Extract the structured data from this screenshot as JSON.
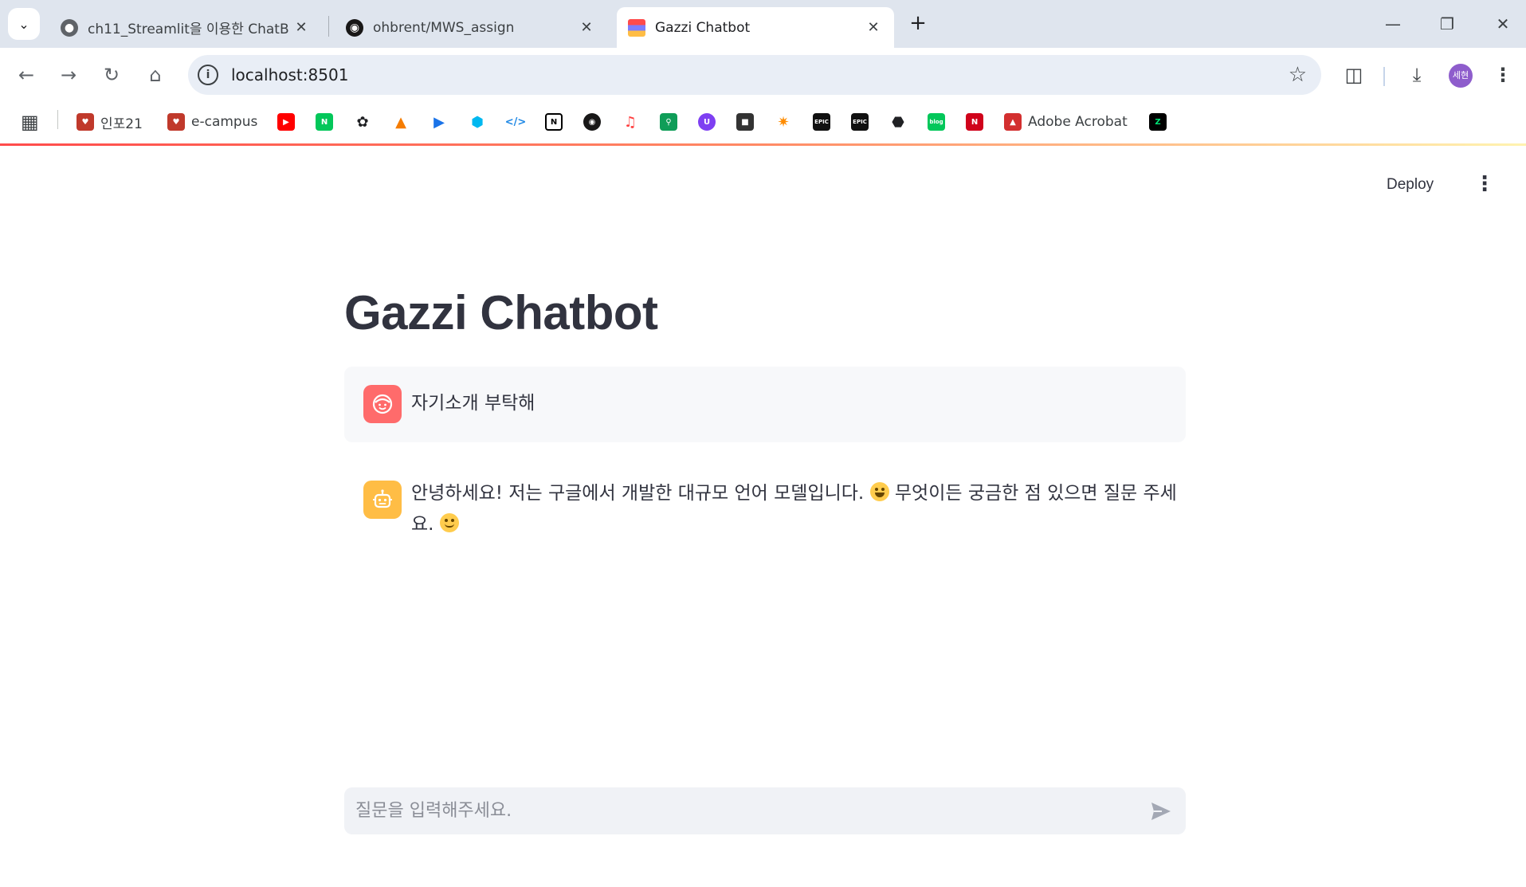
{
  "browser": {
    "tabs": [
      {
        "title": "ch11_Streamlit을 이용한 ChatB",
        "active": false
      },
      {
        "title": "ohbrent/MWS_assign",
        "active": false
      },
      {
        "title": "Gazzi Chatbot",
        "active": true
      }
    ],
    "url": "localhost:8501",
    "profile_initials": "세현",
    "bookmarks": [
      {
        "label": "인포21",
        "icon": "logo-icon",
        "color": "#c0392b"
      },
      {
        "label": "e-campus",
        "icon": "logo-icon",
        "color": "#c0392b"
      },
      {
        "label": "",
        "icon": "youtube-icon",
        "color": "#ff0000"
      },
      {
        "label": "",
        "icon": "naver-icon",
        "color": "#03c75a"
      },
      {
        "label": "",
        "icon": "openai-icon",
        "color": "#202124"
      },
      {
        "label": "",
        "icon": "firebase-icon",
        "color": "#f57c00"
      },
      {
        "label": "",
        "icon": "play-icon",
        "color": "#1a73e8"
      },
      {
        "label": "",
        "icon": "hex-icon",
        "color": "#00b8f0"
      },
      {
        "label": "",
        "icon": "code-icon",
        "color": "#1e88e5"
      },
      {
        "label": "",
        "icon": "notion-icon",
        "color": "#000000"
      },
      {
        "label": "",
        "icon": "github-icon",
        "color": "#181717"
      },
      {
        "label": "",
        "icon": "music-icon",
        "color": "#ff3d3d"
      },
      {
        "label": "",
        "icon": "search-icon",
        "color": "#0f9d58"
      },
      {
        "label": "",
        "icon": "u-icon",
        "color": "#7e3ff2"
      },
      {
        "label": "",
        "icon": "game-icon",
        "color": "#333333"
      },
      {
        "label": "",
        "icon": "runner-icon",
        "color": "#ff8c00"
      },
      {
        "label": "",
        "icon": "epic-icon",
        "color": "#111111"
      },
      {
        "label": "",
        "icon": "epic-icon",
        "color": "#111111"
      },
      {
        "label": "",
        "icon": "cube-icon",
        "color": "#202124"
      },
      {
        "label": "",
        "icon": "blog-icon",
        "color": "#03c75a"
      },
      {
        "label": "",
        "icon": "n-icon",
        "color": "#d0021b"
      },
      {
        "label": "Adobe Acrobat",
        "icon": "acrobat-icon",
        "color": "#d32f2f"
      },
      {
        "label": "",
        "icon": "z-icon",
        "color": "#000000"
      }
    ]
  },
  "app": {
    "deploy_label": "Deploy",
    "title": "Gazzi Chatbot",
    "messages": [
      {
        "role": "user",
        "text": "자기소개 부탁해"
      },
      {
        "role": "assistant",
        "text_part1": "안녕하세요! 저는 구글에서 개발한 대규모 언어 모델입니다. ",
        "text_part2": " 무엇이든 궁금한 점 있으면 질문 주세요. "
      }
    ],
    "chat_input": {
      "placeholder": "질문을 입력해주세요.",
      "value": ""
    },
    "colors": {
      "user_avatar": "#ff6b6b",
      "bot_avatar": "#ffbd45",
      "accent": "#ff4b4b"
    }
  }
}
